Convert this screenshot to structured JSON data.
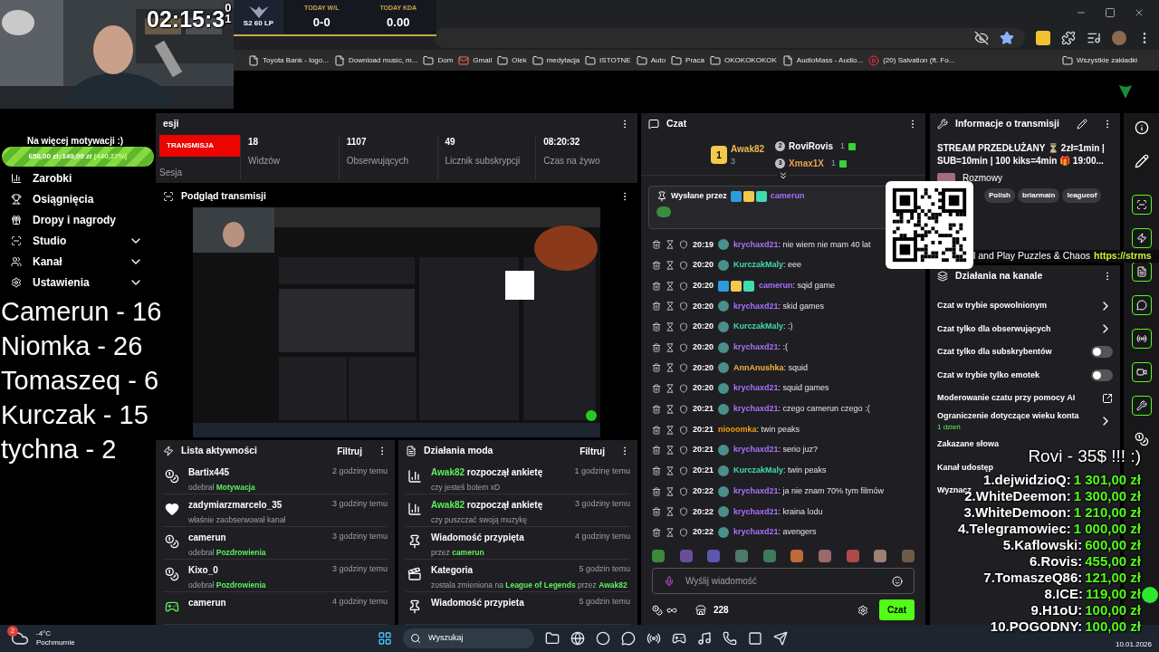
{
  "browser": {
    "bookmarks": [
      {
        "kind": "page",
        "label": "Toyota Bank - logo..."
      },
      {
        "kind": "page",
        "label": "Download music, m..."
      },
      {
        "kind": "folder",
        "label": "Dom"
      },
      {
        "kind": "mail",
        "label": "Gmail"
      },
      {
        "kind": "folder",
        "label": "Olek"
      },
      {
        "kind": "folder",
        "label": "medytacja"
      },
      {
        "kind": "folder",
        "label": "ISTOTNE"
      },
      {
        "kind": "folder",
        "label": "Auto"
      },
      {
        "kind": "folder",
        "label": "Praca"
      },
      {
        "kind": "folder",
        "label": "OKOKOKOKOK"
      },
      {
        "kind": "page",
        "label": "AudioMass - Audio..."
      },
      {
        "kind": "video",
        "label": "(20) Salvation (ft. Fo..."
      }
    ],
    "other_bookmarks": "Wszystkie zakładki"
  },
  "sidebar": {
    "items": [
      {
        "label": "Zarobki",
        "expandable": false
      },
      {
        "label": "Osiągnięcia",
        "expandable": false
      },
      {
        "label": "Dropy i nagrody",
        "expandable": false
      },
      {
        "label": "Studio",
        "expandable": true
      },
      {
        "label": "Kanał",
        "expandable": true
      },
      {
        "label": "Ustawienia",
        "expandable": true
      }
    ]
  },
  "session_stats": {
    "title": "esji",
    "live_badge": "TRANSMISJA",
    "live_caption": "Sesja",
    "stats": [
      {
        "value": "18",
        "label": "Widzów"
      },
      {
        "value": "1107",
        "label": "Obserwujących"
      },
      {
        "value": "49",
        "label": "Licznik subskrypcji"
      },
      {
        "value": "08:20:32",
        "label": "Czas na żywo"
      }
    ]
  },
  "preview": {
    "title": "Podgląd transmisji",
    "kind": "picture"
  },
  "activity": {
    "title": "Lista aktywności",
    "filter": "Filtruj",
    "items": [
      {
        "kind": "points",
        "user": "Bartix445",
        "time": "2 godziny temu",
        "detail": [
          {
            "text": "odebrał ",
            "accent": false
          },
          {
            "text": "Motywacja",
            "accent": true
          }
        ]
      },
      {
        "kind": "follow",
        "user": "zadymiarzmarcelo_35",
        "time": "3 godziny temu",
        "detail": [
          {
            "text": "właśnie zaobserwował kanał",
            "accent": false
          }
        ]
      },
      {
        "kind": "points",
        "user": "camerun",
        "time": "3 godziny temu",
        "detail": [
          {
            "text": "odebrał ",
            "accent": false
          },
          {
            "text": "Pozdrowienia",
            "accent": true
          }
        ]
      },
      {
        "kind": "points",
        "user": "Kixo_0",
        "time": "3 godziny temu",
        "detail": [
          {
            "text": "odebrał ",
            "accent": false
          },
          {
            "text": "Pozdrowienia",
            "accent": true
          }
        ]
      },
      {
        "kind": "sub",
        "user": "camerun",
        "time": "4 godziny temu"
      }
    ]
  },
  "mod_actions": {
    "title": "Działania moda",
    "filter": "Filtruj",
    "items": [
      {
        "kind": "poll",
        "title": [
          {
            "text": "Awak82",
            "accent": true
          },
          {
            "text": " rozpoczął ankietę",
            "accent": false
          }
        ],
        "time": "1 godzinę temu",
        "detail": [
          {
            "text": "czy jesteś botem xD",
            "accent": false
          }
        ]
      },
      {
        "kind": "poll",
        "title": [
          {
            "text": "Awak82",
            "accent": true
          },
          {
            "text": " rozpoczął ankietę",
            "accent": false
          }
        ],
        "time": "3 godziny temu",
        "detail": [
          {
            "text": "czy puszczać swoją muzykę",
            "accent": false
          }
        ]
      },
      {
        "kind": "pin",
        "title": [
          {
            "text": "Wiadomość przypięta",
            "accent": false
          }
        ],
        "time": "4 godziny temu",
        "detail": [
          {
            "text": "przez ",
            "accent": false
          },
          {
            "text": "camerun",
            "accent": true
          }
        ]
      },
      {
        "kind": "category",
        "title": [
          {
            "text": "Kategoria",
            "accent": false
          }
        ],
        "time": "5 godzin temu",
        "detail": [
          {
            "text": "zostala zmieniona na ",
            "accent": false
          },
          {
            "text": "League of Legends",
            "accent": true
          },
          {
            "text": " przez ",
            "accent": false
          },
          {
            "text": "Awak82",
            "accent": true
          }
        ]
      },
      {
        "kind": "pin",
        "title": [
          {
            "text": "Wiadomość przypieta",
            "accent": false
          }
        ],
        "time": "5 godzin temu"
      }
    ]
  },
  "chat": {
    "title": "Czat",
    "leaders": [
      {
        "rank": "1",
        "name": "Awak82",
        "count": "3",
        "color": "#f0b94a"
      },
      {
        "rank": "2",
        "name": "RoviRovis",
        "count": "1",
        "color": "#ffffff"
      },
      {
        "rank": "3",
        "name": "Xmax1X",
        "count": "1",
        "color": "#e8a04a"
      }
    ],
    "pinned": {
      "label": "Wysłane przez",
      "user": "camerun"
    },
    "messages": [
      {
        "time": "20:19",
        "user": "krychaxd21",
        "color": "#a970ff",
        "kind": "subscriber",
        "text": ": nie wiem nie mam 40 lat"
      },
      {
        "time": "20:20",
        "user": "KurczakMaly",
        "color": "#3ddbb0",
        "kind": "subscriber",
        "text": ": eee"
      },
      {
        "time": "20:20",
        "user": "camerun",
        "color": "#a970ff",
        "kind": "moderator",
        "text": ": sqid game"
      },
      {
        "time": "20:20",
        "user": "krychaxd21",
        "color": "#a970ff",
        "kind": "subscriber",
        "text": ": skid games"
      },
      {
        "time": "20:20",
        "user": "KurczakMaly",
        "color": "#3ddbb0",
        "kind": "subscriber",
        "text": ": :)"
      },
      {
        "time": "20:20",
        "user": "krychaxd21",
        "color": "#a970ff",
        "kind": "subscriber",
        "text": ": :("
      },
      {
        "time": "20:20",
        "user": "AnnAnushka",
        "color": "#f5b041",
        "kind": "subscriber",
        "text": ": squid"
      },
      {
        "time": "20:20",
        "user": "krychaxd21",
        "color": "#a970ff",
        "kind": "subscriber",
        "text": ": squid games"
      },
      {
        "time": "20:21",
        "user": "krychaxd21",
        "color": "#a970ff",
        "kind": "subscriber",
        "text": ": czego camerun czego :("
      },
      {
        "time": "20:21",
        "user": "niooomka",
        "color": "#f59f00",
        "kind": "plain",
        "text": ": twin peaks"
      },
      {
        "time": "20:21",
        "user": "krychaxd21",
        "color": "#a970ff",
        "kind": "subscriber",
        "text": ": serio juz?"
      },
      {
        "time": "20:21",
        "user": "KurczakMaly",
        "color": "#3ddbb0",
        "kind": "subscriber",
        "text": ": twin peaks"
      },
      {
        "time": "20:22",
        "user": "krychaxd21",
        "color": "#a970ff",
        "kind": "subscriber",
        "text": ": ja nie znam 70% tym filmów"
      },
      {
        "time": "20:22",
        "user": "krychaxd21",
        "color": "#a970ff",
        "kind": "subscriber",
        "text": ": kraina lodu"
      },
      {
        "time": "20:22",
        "user": "krychaxd21",
        "color": "#a970ff",
        "kind": "subscriber",
        "text": ": avengers"
      }
    ],
    "input": {
      "placeholder": "Wyślij wiadomość"
    },
    "store_count": "228",
    "send": "Czat"
  },
  "stream_info": {
    "title": "Informacje o transmisji",
    "description": "STREAM PRZEDŁUŻANY ⏳ 2zł=1min | SUB=10min | 100 kiks=4min 🎁 19:00...",
    "category": "Rozmowy",
    "tags": [
      "Polish",
      "briarmain",
      "leagueof"
    ]
  },
  "channel_actions": {
    "title": "Działania na kanale",
    "items": [
      {
        "kind": "link",
        "label": "Czat w trybie spowolnionym"
      },
      {
        "kind": "link",
        "label": "Czat tylko dla obserwujących"
      },
      {
        "kind": "toggle",
        "label": "Czat tylko dla subskrybentów",
        "on": false
      },
      {
        "kind": "toggle",
        "label": "Czat w trybie tylko emotek",
        "on": false
      },
      {
        "kind": "external",
        "label": "Moderowanie czatu przy pomocy AI"
      },
      {
        "kind": "link",
        "label": "Ograniczenie dotyczące wieku konta",
        "note": "1 dzień"
      },
      {
        "kind": "plain",
        "label": "Zakazane słowa"
      },
      {
        "kind": "plain",
        "label": "Kanał udostęp"
      },
      {
        "kind": "plain",
        "label": "Wyznacz"
      }
    ]
  },
  "overlays": {
    "timer": {
      "text": "02:15:3",
      "rolling": [
        "0",
        "1"
      ]
    },
    "scoreboard": {
      "rank": "S2 60 LP",
      "stats": [
        {
          "label": "TODAY W/L",
          "value": "0-0"
        },
        {
          "label": "TODAY KDA",
          "value": "0.00"
        }
      ]
    },
    "goal": {
      "title": "Na więcej motywacji :)",
      "current": "656,00 zł",
      "separator": " z ",
      "target": "149,00 zł",
      "percent": "(440,27%)",
      "level": 1
    },
    "counts": [
      "Camerun - 16",
      "Niomka - 26",
      "Tomaszeq - 6",
      "Kurczak - 15",
      "tychna - 2"
    ],
    "banner": {
      "text": "l and Play Puzzles & Chaos",
      "link": "https://strms"
    },
    "donors": {
      "title": "Rovi - 35$ !!! :)",
      "entries": [
        {
          "rank": "1.",
          "name": "dejwidzioQ:",
          "amount": "1 301,00 zł"
        },
        {
          "rank": "2.",
          "name": "WhiteDeemon:",
          "amount": "1 300,00 zł"
        },
        {
          "rank": "3.",
          "name": "WhiteDemoon:",
          "amount": "1 210,00 zł"
        },
        {
          "rank": "4.",
          "name": "Telegramowiec:",
          "amount": "1 000,00 zł"
        },
        {
          "rank": "5.",
          "name": "Kaflowski:",
          "amount": "600,00 zł"
        },
        {
          "rank": "6.",
          "name": "Rovis:",
          "amount": "455,00 zł"
        },
        {
          "rank": "7.",
          "name": "TomaszeQ86:",
          "amount": "121,00 zł"
        },
        {
          "rank": "8.",
          "name": "ICE:",
          "amount": "119,00 zł"
        },
        {
          "rank": "9.",
          "name": "H1oU:",
          "amount": "100,00 zł"
        },
        {
          "rank": "10.",
          "name": "POGODNY:",
          "amount": "100,00 zł"
        }
      ]
    }
  },
  "taskbar": {
    "weather": {
      "badge": "2",
      "temp": "-4°C",
      "desc": "Pochmurnie"
    },
    "search": "Wyszukaj",
    "date": "10.01.2026"
  }
}
